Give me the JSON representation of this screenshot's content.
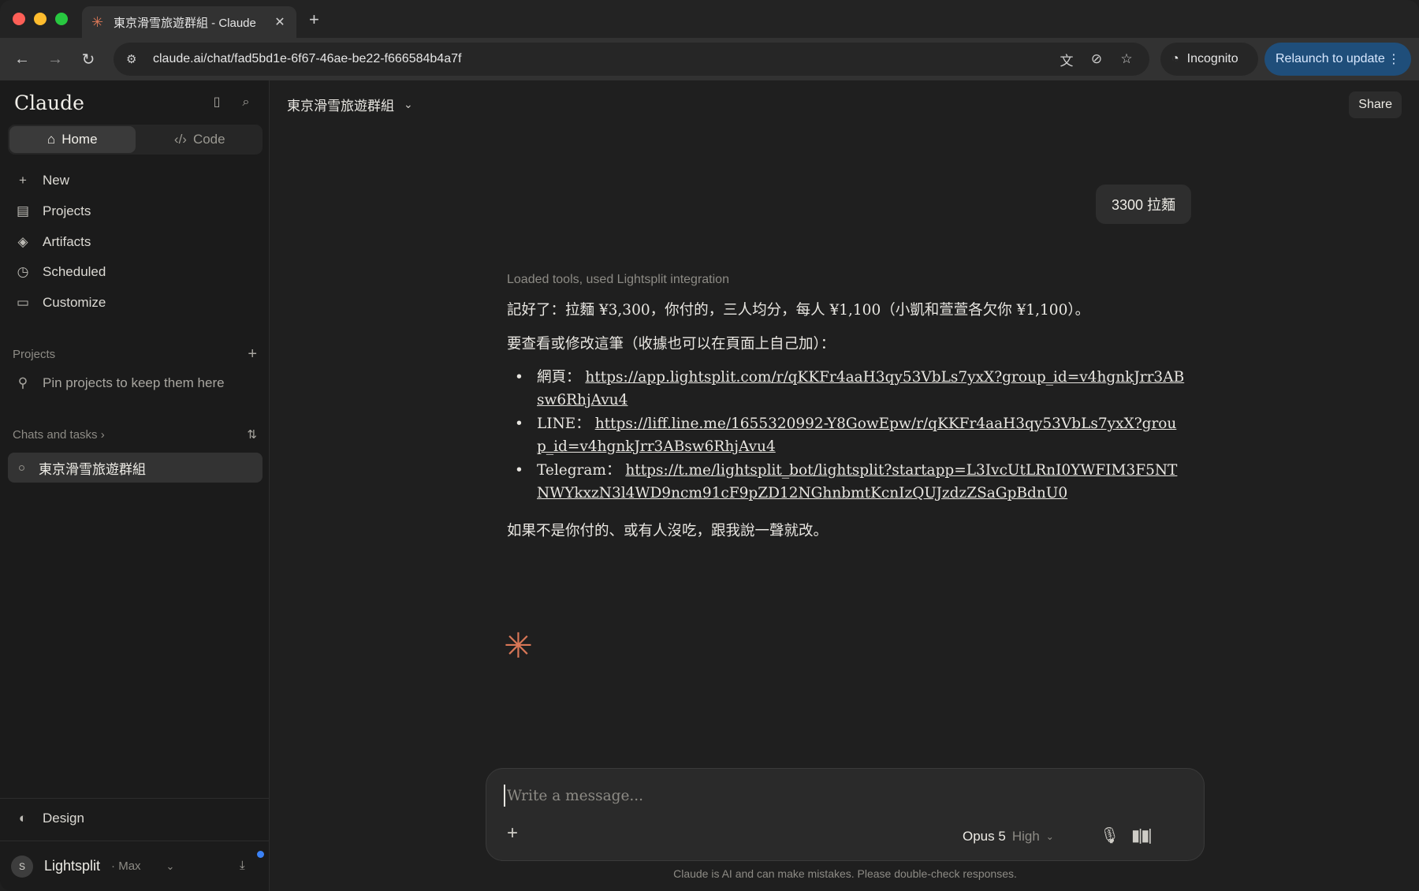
{
  "browser": {
    "tab_title": "東京滑雪旅遊群組 - Claude",
    "url": "claude.ai/chat/fad5bd1e-6f67-46ae-be22-f666584b4a7f",
    "incognito_label": "Incognito",
    "relaunch_label": "Relaunch to update"
  },
  "sidebar": {
    "brand": "Claude",
    "segments": {
      "home": "Home",
      "code": "Code"
    },
    "nav": [
      {
        "label": "New",
        "icon": "plus-icon"
      },
      {
        "label": "Projects",
        "icon": "projects-icon"
      },
      {
        "label": "Artifacts",
        "icon": "artifacts-icon"
      },
      {
        "label": "Scheduled",
        "icon": "clock-icon"
      },
      {
        "label": "Customize",
        "icon": "briefcase-icon"
      }
    ],
    "projects_heading": "Projects",
    "pin_hint": "Pin projects to keep them here",
    "chats_heading": "Chats and tasks",
    "chats": [
      {
        "label": "東京滑雪旅遊群組"
      }
    ],
    "design_label": "Design",
    "user": {
      "initial": "S",
      "name": "Lightsplit",
      "plan": "· Max"
    }
  },
  "main": {
    "chat_title": "東京滑雪旅遊群組",
    "share_label": "Share",
    "user_message": "3300 拉麵",
    "tools_line": "Loaded tools, used Lightsplit integration",
    "response": {
      "line1": "記好了：拉麵 ¥3,300，你付的，三人均分，每人 ¥1,100（小凱和萱萱各欠你 ¥1,100）。",
      "line2": "要查看或修改這筆（收據也可以在頁面上自己加）：",
      "links": [
        {
          "label": "網頁：",
          "url": "https://app.lightsplit.com/r/qKKFr4aaH3qy53VbLs7yxX?group_id=v4hgnkJrr3ABsw6RhjAvu4"
        },
        {
          "label": "LINE：",
          "url": "https://liff.line.me/1655320992-Y8GowEpw/r/qKKFr4aaH3qy53VbLs7yxX?group_id=v4hgnkJrr3ABsw6RhjAvu4"
        },
        {
          "label": "Telegram：",
          "url": "https://t.me/lightsplit_bot/lightsplit?startapp=L3IvcUtLRnI0YWFIM3F5NTNWYkxzN3l4WD9ncm91cF9pZD12NGhnbmtKcnIzQUJzdzZSaGpBdnU0"
        }
      ],
      "closing": "如果不是你付的、或有人沒吃，跟我說一聲就改。"
    },
    "composer": {
      "placeholder": "Write a message...",
      "model_name": "Opus 5",
      "model_level": "High"
    },
    "disclaimer": "Claude is AI and can make mistakes. Please double-check responses."
  },
  "colors": {
    "accent": "#d97757",
    "relaunch_bg": "#1f4e7a",
    "notification": "#3b82f6"
  }
}
